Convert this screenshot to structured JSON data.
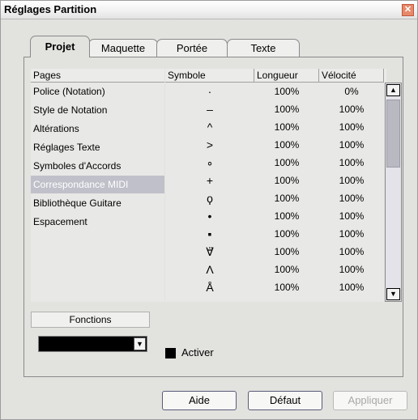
{
  "window": {
    "title": "Réglages Partition",
    "close_symbol": "✕"
  },
  "tabs": [
    {
      "label": "Projet",
      "active": true
    },
    {
      "label": "Maquette",
      "active": false
    },
    {
      "label": "Portée",
      "active": false
    },
    {
      "label": "Texte",
      "active": false
    }
  ],
  "pages": {
    "header": "Pages",
    "items": [
      {
        "label": "Police (Notation)",
        "selected": false
      },
      {
        "label": "Style de Notation",
        "selected": false
      },
      {
        "label": "Altérations",
        "selected": false
      },
      {
        "label": "Réglages Texte",
        "selected": false
      },
      {
        "label": "Symboles d'Accords",
        "selected": false
      },
      {
        "label": "Correspondance MIDI",
        "selected": true
      },
      {
        "label": "Bibliothèque Guitare",
        "selected": false
      },
      {
        "label": "Espacement",
        "selected": false
      }
    ]
  },
  "table": {
    "columns": [
      "Symbole",
      "Longueur",
      "Vélocité"
    ],
    "rows": [
      {
        "symbol": "·",
        "length": "100%",
        "velocity": "0%"
      },
      {
        "symbol": "–",
        "length": "100%",
        "velocity": "100%"
      },
      {
        "symbol": "^",
        "length": "100%",
        "velocity": "100%"
      },
      {
        "symbol": ">",
        "length": "100%",
        "velocity": "100%"
      },
      {
        "symbol": "∘",
        "length": "100%",
        "velocity": "100%"
      },
      {
        "symbol": "+",
        "length": "100%",
        "velocity": "100%"
      },
      {
        "symbol": "ϙ",
        "length": "100%",
        "velocity": "100%"
      },
      {
        "symbol": "•",
        "length": "100%",
        "velocity": "100%"
      },
      {
        "symbol": "▪",
        "length": "100%",
        "velocity": "100%"
      },
      {
        "symbol": "∀̈",
        "length": "100%",
        "velocity": "100%"
      },
      {
        "symbol": "Λ",
        "length": "100%",
        "velocity": "100%"
      },
      {
        "symbol": "Å",
        "length": "100%",
        "velocity": "100%"
      }
    ]
  },
  "scrollbar": {
    "up": "▲",
    "down": "▼"
  },
  "functions": {
    "label": "Fonctions",
    "dropdown_arrow": "▼"
  },
  "activer": {
    "label": "Activer"
  },
  "buttons": {
    "aide": "Aide",
    "defaut": "Défaut",
    "appliquer": "Appliquer"
  }
}
